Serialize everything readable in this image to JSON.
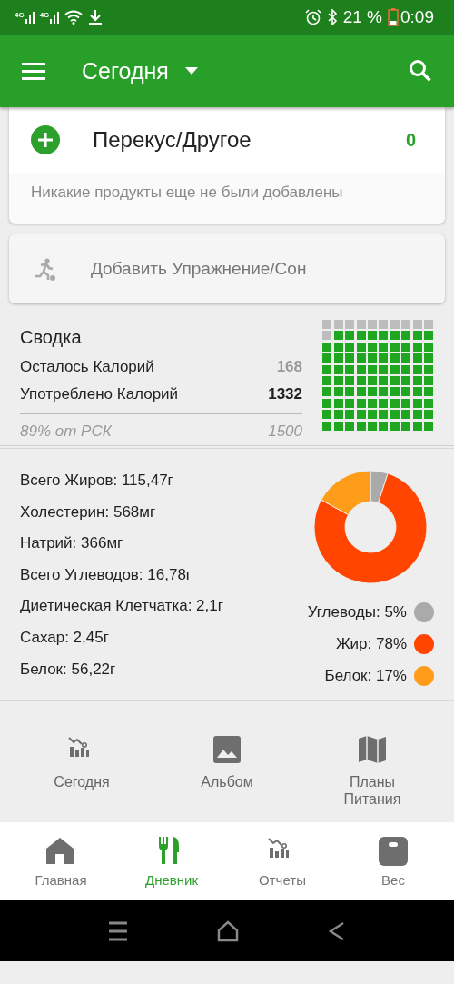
{
  "status_bar": {
    "signal_1": "4G",
    "signal_2": "4G",
    "battery": "21 %",
    "time": "0:09"
  },
  "app_bar": {
    "title": "Сегодня"
  },
  "meal_card": {
    "title": "Перекус/Другое",
    "calories": "0",
    "empty_message": "Никакие продукты еще не были добавлены"
  },
  "exercise_card": {
    "label": "Добавить Упражнение/Сон"
  },
  "summary": {
    "title": "Сводка",
    "rows": [
      {
        "label": "Осталось Калорий",
        "value": "168",
        "emphasis": false
      },
      {
        "label": "Употреблено Калорий",
        "value": "1332",
        "emphasis": true
      }
    ],
    "percent_label": "89% от РСК",
    "target": "1500"
  },
  "nutrients": {
    "items": [
      "Всего Жиров: 115,47г",
      "Холестерин: 568мг",
      "Натрий: 366мг",
      "Всего Углеводов: 16,78г",
      "Диетическая Клетчатка: 2,1г",
      "Сахар: 2,45г",
      "Белок: 56,22г"
    ],
    "chart_data": {
      "type": "donut",
      "values": [
        5,
        78,
        17
      ]
    },
    "legend": [
      {
        "label": "Углеводы: 5%",
        "color": "#aaaaaa"
      },
      {
        "label": "Жир: 78%",
        "color": "#ff4500"
      },
      {
        "label": "Белок: 17%",
        "color": "#ff9c1a"
      }
    ]
  },
  "shortcuts": [
    {
      "label": "Сегодня",
      "kind": "chart"
    },
    {
      "label": "Альбом",
      "kind": "image"
    },
    {
      "label": "Планы Питания",
      "kind": "map"
    }
  ],
  "bottom_nav": [
    {
      "label": "Главная",
      "kind": "home",
      "selected": false
    },
    {
      "label": "Дневник",
      "kind": "diary",
      "selected": true
    },
    {
      "label": "Отчеты",
      "kind": "chart",
      "selected": false
    },
    {
      "label": "Вес",
      "kind": "scale",
      "selected": false
    }
  ]
}
